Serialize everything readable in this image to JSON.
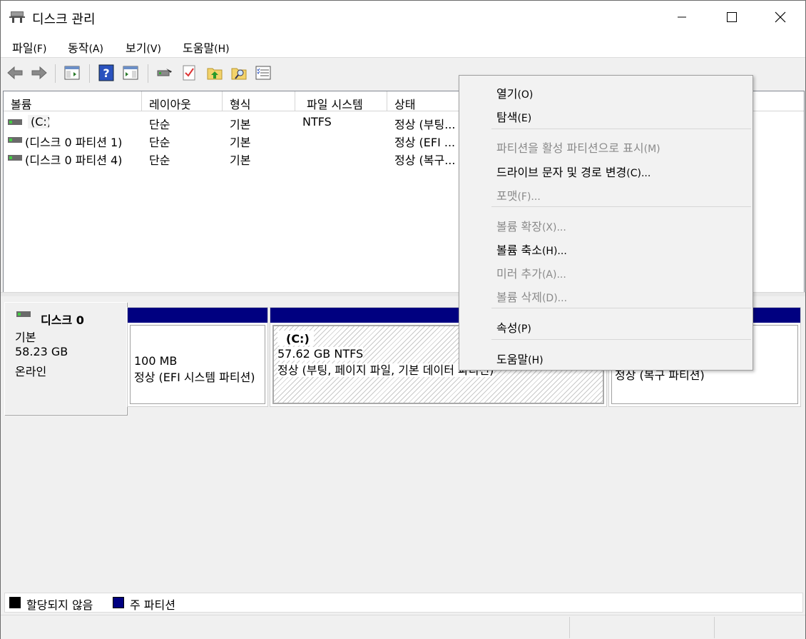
{
  "window": {
    "title": "디스크 관리"
  },
  "menu": [
    {
      "label": "파일",
      "accel": "(F)"
    },
    {
      "label": "동작",
      "accel": "(A)"
    },
    {
      "label": "보기",
      "accel": "(V)"
    },
    {
      "label": "도움말",
      "accel": "(H)"
    }
  ],
  "volume_list": {
    "columns": [
      "볼륨",
      "레이아웃",
      "형식",
      "파일 시스템",
      "상태"
    ],
    "rows": [
      {
        "volume": "(C:)",
        "layout": "단순",
        "type": "기본",
        "fs": "NTFS",
        "status": "정상 (부팅..."
      },
      {
        "volume": "(디스크 0 파티션 1)",
        "layout": "단순",
        "type": "기본",
        "fs": "",
        "status": "정상 (EFI ..."
      },
      {
        "volume": "(디스크 0 파티션 4)",
        "layout": "단순",
        "type": "기본",
        "fs": "",
        "status": "정상 (복구..."
      }
    ]
  },
  "disk": {
    "name": "디스크 0",
    "kind": "기본",
    "size": "58.23 GB",
    "state": "온라인",
    "partitions": [
      {
        "name": "",
        "size": "100 MB",
        "status": "정상 (EFI 시스템 파티션)"
      },
      {
        "name": "(C:)",
        "size": "57.62 GB NTFS",
        "status": "정상 (부팅, 페이지 파일, 기본 데이터 파티션)"
      },
      {
        "name": "",
        "size": "",
        "status": "정상 (복구 파티션)"
      }
    ]
  },
  "legend": [
    {
      "label": "할당되지 않음",
      "color": "#000000"
    },
    {
      "label": "주 파티션",
      "color": "#000080"
    }
  ],
  "context_menu": {
    "open": {
      "label": "열기",
      "accel": "(O)"
    },
    "explore": {
      "label": "탐색",
      "accel": "(E)"
    },
    "mark_active": {
      "label": "파티션을 활성 파티션으로 표시",
      "accel": "(M)"
    },
    "change_letter": {
      "label": "드라이브 문자 및 경로 변경",
      "accel": "(C)..."
    },
    "format": {
      "label": "포맷",
      "accel": "(F)..."
    },
    "extend": {
      "label": "볼륨 확장",
      "accel": "(X)..."
    },
    "shrink": {
      "label": "볼륨 축소",
      "accel": "(H)..."
    },
    "mirror": {
      "label": "미러 추가",
      "accel": "(A)..."
    },
    "delete": {
      "label": "볼륨 삭제",
      "accel": "(D)..."
    },
    "properties": {
      "label": "속성",
      "accel": "(P)"
    },
    "help": {
      "label": "도움말",
      "accel": "(H)"
    }
  },
  "colors": {
    "primary_partition": "#000080",
    "unallocated": "#000000"
  }
}
